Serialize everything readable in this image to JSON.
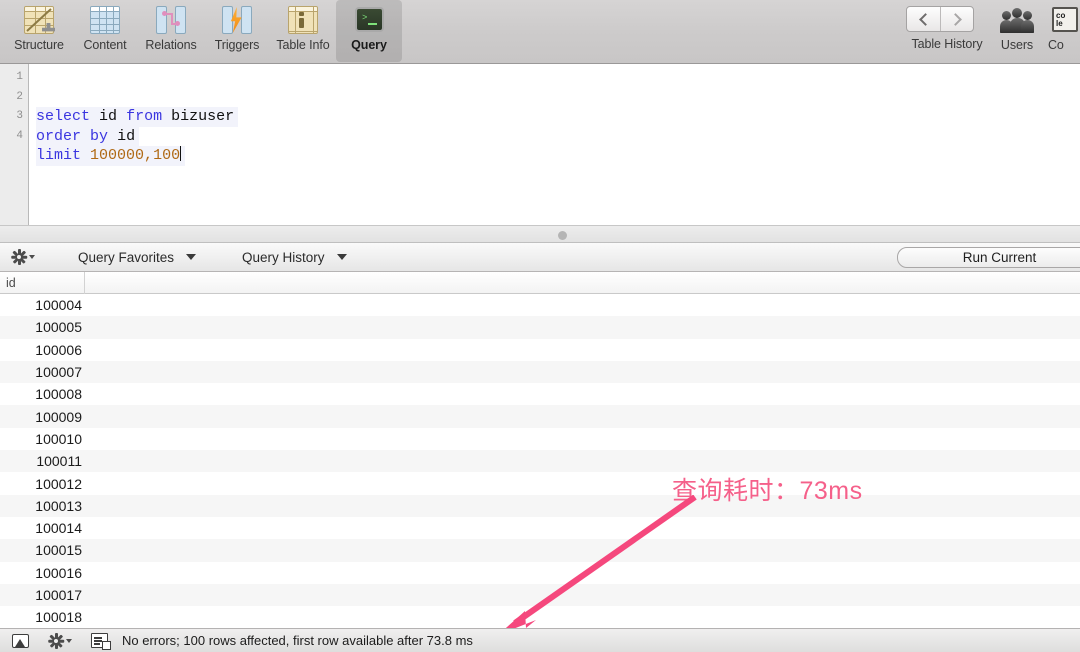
{
  "toolbar": {
    "tabs": [
      {
        "label": "Structure",
        "icon": "structure-icon",
        "selected": false
      },
      {
        "label": "Content",
        "icon": "content-icon",
        "selected": false
      },
      {
        "label": "Relations",
        "icon": "relations-icon",
        "selected": false
      },
      {
        "label": "Triggers",
        "icon": "triggers-icon",
        "selected": false
      },
      {
        "label": "Table Info",
        "icon": "table-info-icon",
        "selected": false
      },
      {
        "label": "Query",
        "icon": "query-terminal-icon",
        "selected": true
      }
    ],
    "right": {
      "back_icon": "chevron-left-icon",
      "forward_icon": "chevron-right-icon",
      "nav_label": "Table History",
      "users_label": "Users",
      "users_icon": "users-icon",
      "console_label": "Co",
      "console_icon": "console-icon"
    }
  },
  "editor": {
    "line_numbers": [
      "1",
      "2",
      "3",
      "4"
    ],
    "lines": [
      {
        "tokens": []
      },
      {
        "tokens": [
          {
            "t": "select",
            "c": "kw"
          },
          {
            "t": " ",
            "c": "id"
          },
          {
            "t": "id",
            "c": "id"
          },
          {
            "t": " ",
            "c": "id"
          },
          {
            "t": "from",
            "c": "kw"
          },
          {
            "t": " ",
            "c": "id"
          },
          {
            "t": "bizuser",
            "c": "id"
          }
        ]
      },
      {
        "tokens": [
          {
            "t": "order",
            "c": "kw"
          },
          {
            "t": " ",
            "c": "id"
          },
          {
            "t": "by",
            "c": "kw"
          },
          {
            "t": " ",
            "c": "id"
          },
          {
            "t": "id",
            "c": "id"
          }
        ]
      },
      {
        "tokens": [
          {
            "t": "limit",
            "c": "kw"
          },
          {
            "t": " ",
            "c": "id"
          },
          {
            "t": "100000",
            "c": "num"
          },
          {
            "t": ",",
            "c": "num"
          },
          {
            "t": "100",
            "c": "num"
          }
        ]
      }
    ],
    "plain_text": "select id from bizuser\norder by id\nlimit 100000,100"
  },
  "query_bar": {
    "gear_icon": "gear-icon",
    "favorites_label": "Query Favorites",
    "history_label": "Query History",
    "run_label": "Run Current"
  },
  "results": {
    "columns": [
      "id"
    ],
    "rows": [
      "100004",
      "100005",
      "100006",
      "100007",
      "100008",
      "100009",
      "100010",
      "100011",
      "100012",
      "100013",
      "100014",
      "100015",
      "100016",
      "100017",
      "100018"
    ]
  },
  "annotation": {
    "text": "查询耗时：73ms",
    "color": "#f5608a",
    "arrow_color": "#f5487d"
  },
  "status_bar": {
    "image_icon": "image-preview-icon",
    "gear_icon": "gear-icon",
    "doc_icon": "table-document-icon",
    "message": "No errors; 100 rows affected, first row available after 73.8 ms"
  }
}
